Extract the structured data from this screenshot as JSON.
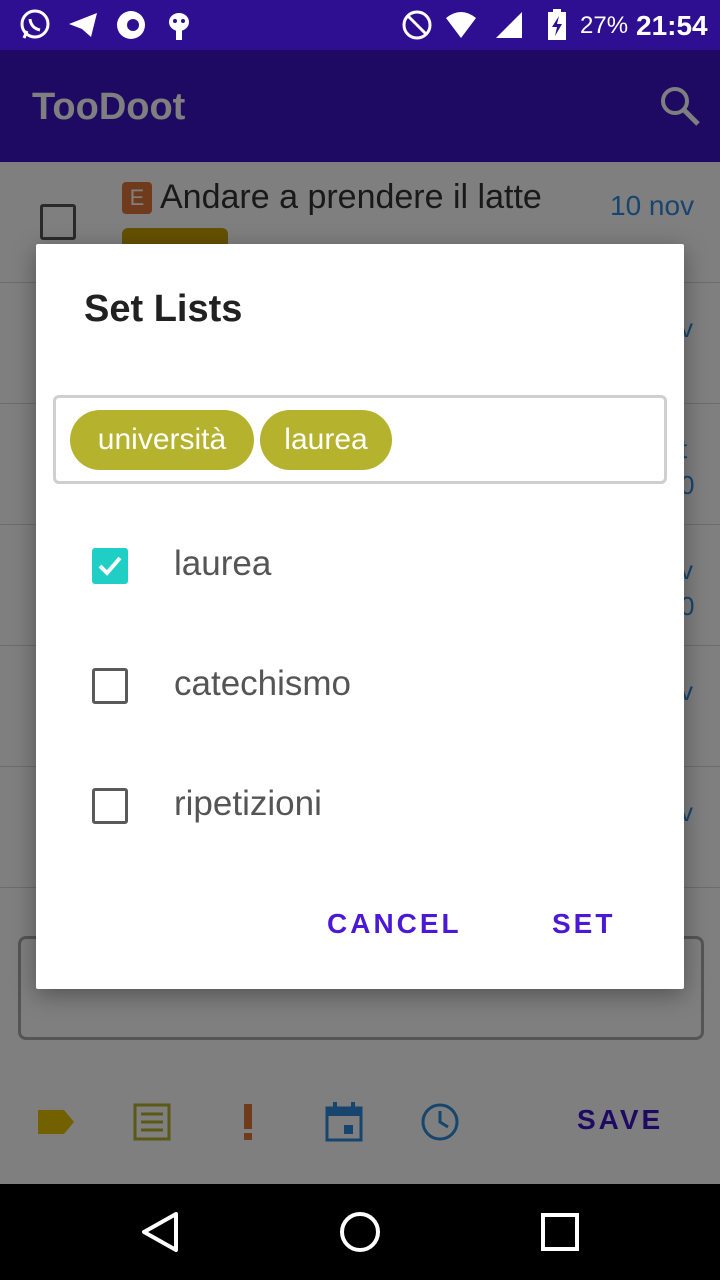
{
  "status_bar": {
    "battery": "27%",
    "time": "21:54",
    "colors": {
      "background": "#2e0f92"
    }
  },
  "app_bar": {
    "title": "TooDoot",
    "colors": {
      "background": "#3d14c4"
    }
  },
  "list": {
    "items": [
      {
        "priority": "E",
        "title": "Andare a prendere il latte",
        "date": "10 nov"
      }
    ],
    "partial_dates": [
      "v",
      "t",
      "0",
      "v",
      "0",
      "v",
      "v"
    ]
  },
  "bottom_toolbar": {
    "save_label": "SAVE"
  },
  "dialog": {
    "title": "Set Lists",
    "chips": [
      "università",
      "laurea"
    ],
    "options": [
      {
        "label": "laurea",
        "checked": true
      },
      {
        "label": "catechismo",
        "checked": false
      },
      {
        "label": "ripetizioni",
        "checked": false
      }
    ],
    "cancel_label": "CANCEL",
    "set_label": "SET",
    "colors": {
      "chip": "#b5b22e",
      "checkbox_checked": "#1fcfc6",
      "button_text": "#4b18d6"
    }
  }
}
